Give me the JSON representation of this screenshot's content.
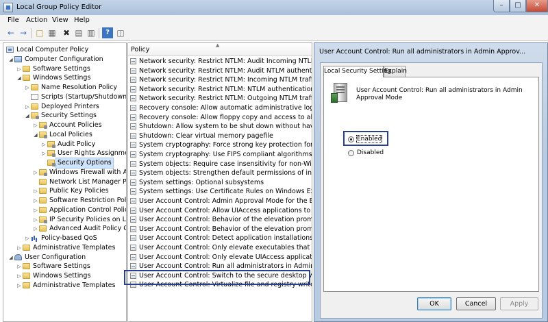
{
  "window": {
    "title": "Local Group Policy Editor"
  },
  "menu": [
    "File",
    "Action",
    "View",
    "Help"
  ],
  "toolbar": {
    "icons": [
      "back-arrow-icon",
      "forward-arrow-icon",
      "up-folder-icon",
      "show-tree-icon",
      "delete-icon",
      "properties-icon",
      "export-list-icon",
      "help-icon",
      "show-hide-pane-icon"
    ]
  },
  "tree": [
    {
      "label": "Local Computer Policy",
      "level": 0,
      "arrow": "",
      "icon": "policy"
    },
    {
      "label": "Computer Configuration",
      "level": 1,
      "arrow": "expanded",
      "icon": "computer"
    },
    {
      "label": "Software Settings",
      "level": 2,
      "arrow": "collapsed",
      "icon": "folder"
    },
    {
      "label": "Windows Settings",
      "level": 2,
      "arrow": "expanded",
      "icon": "folder"
    },
    {
      "label": "Name Resolution Policy",
      "level": 3,
      "arrow": "collapsed",
      "icon": "folder"
    },
    {
      "label": "Scripts (Startup/Shutdown)",
      "level": 3,
      "arrow": "",
      "icon": "doc"
    },
    {
      "label": "Deployed Printers",
      "level": 3,
      "arrow": "collapsed",
      "icon": "folder"
    },
    {
      "label": "Security Settings",
      "level": 3,
      "arrow": "expanded",
      "icon": "lock"
    },
    {
      "label": "Account Policies",
      "level": 4,
      "arrow": "collapsed",
      "icon": "lock"
    },
    {
      "label": "Local Policies",
      "level": 4,
      "arrow": "expanded",
      "icon": "lock"
    },
    {
      "label": "Audit Policy",
      "level": 5,
      "arrow": "collapsed",
      "icon": "lock"
    },
    {
      "label": "User Rights Assignme",
      "level": 5,
      "arrow": "collapsed",
      "icon": "lock"
    },
    {
      "label": "Security Options",
      "level": 5,
      "arrow": "",
      "icon": "lock",
      "selected": true
    },
    {
      "label": "Windows Firewall with A",
      "level": 4,
      "arrow": "collapsed",
      "icon": "lock"
    },
    {
      "label": "Network List Manager Po",
      "level": 4,
      "arrow": "",
      "icon": "folder"
    },
    {
      "label": "Public Key Policies",
      "level": 4,
      "arrow": "collapsed",
      "icon": "folder"
    },
    {
      "label": "Software Restriction Polic",
      "level": 4,
      "arrow": "collapsed",
      "icon": "folder"
    },
    {
      "label": "Application Control Polic",
      "level": 4,
      "arrow": "collapsed",
      "icon": "folder"
    },
    {
      "label": "IP Security Policies on Lo",
      "level": 4,
      "arrow": "collapsed",
      "icon": "lock"
    },
    {
      "label": "Advanced Audit Policy C",
      "level": 4,
      "arrow": "collapsed",
      "icon": "folder"
    },
    {
      "label": "Policy-based QoS",
      "level": 3,
      "arrow": "collapsed",
      "icon": "chart"
    },
    {
      "label": "Administrative Templates",
      "level": 2,
      "arrow": "collapsed",
      "icon": "folder"
    },
    {
      "label": "User Configuration",
      "level": 1,
      "arrow": "expanded",
      "icon": "user"
    },
    {
      "label": "Software Settings",
      "level": 2,
      "arrow": "collapsed",
      "icon": "folder"
    },
    {
      "label": "Windows Settings",
      "level": 2,
      "arrow": "collapsed",
      "icon": "folder"
    },
    {
      "label": "Administrative Templates",
      "level": 2,
      "arrow": "collapsed",
      "icon": "folder"
    }
  ],
  "list": {
    "column_header": "Policy",
    "rows": [
      "Network security: Restrict NTLM: Audit Incoming NTLM Tra...",
      "Network security: Restrict NTLM: Audit NTLM authenticatio...",
      "Network security: Restrict NTLM: Incoming NTLM traffic",
      "Network security: Restrict NTLM: NTLM authentication in th...",
      "Network security: Restrict NTLM: Outgoing NTLM traffic to ...",
      "Recovery console: Allow automatic administrative logon",
      "Recovery console: Allow floppy copy and access to all drives...",
      "Shutdown: Allow system to be shut down without having to...",
      "Shutdown: Clear virtual memory pagefile",
      "System cryptography: Force strong key protection for user k...",
      "System cryptography: Use FIPS compliant algorithms for en...",
      "System objects: Require case insensitivity for non-Windows ...",
      "System objects: Strengthen default permissions of internal s...",
      "System settings: Optional subsystems",
      "System settings: Use Certificate Rules on Windows Executabl...",
      "User Account Control: Admin Approval Mode for the Built-i...",
      "User Account Control: Allow UIAccess applications to prom...",
      "User Account Control: Behavior of the elevation prompt for ...",
      "User Account Control: Behavior of the elevation prompt for ...",
      "User Account Control: Detect application installations and p...",
      "User Account Control: Only elevate executables that are sign...",
      "User Account Control: Only elevate UIAccess applications th...",
      "User Account Control: Run all administrators in Admin Appro...",
      "User Account Control: Switch to the secure desktop when pr...",
      "User Account Control: Virtualize file and registry write failure..."
    ],
    "selected_index": 22
  },
  "dialog": {
    "title": "User Account Control: Run all administrators in Admin Approv...",
    "tabs": [
      "Local Security Setting",
      "Explain"
    ],
    "description": "User Account Control: Run all administrators in Admin Approval Mode",
    "options": [
      {
        "label": "Enabled",
        "checked": true
      },
      {
        "label": "Disabled",
        "checked": false
      }
    ],
    "buttons": {
      "ok": "OK",
      "cancel": "Cancel",
      "apply": "Apply"
    }
  },
  "colors": {
    "highlight_border": "#273f8e",
    "selection_bg": "#cfe3fa"
  }
}
